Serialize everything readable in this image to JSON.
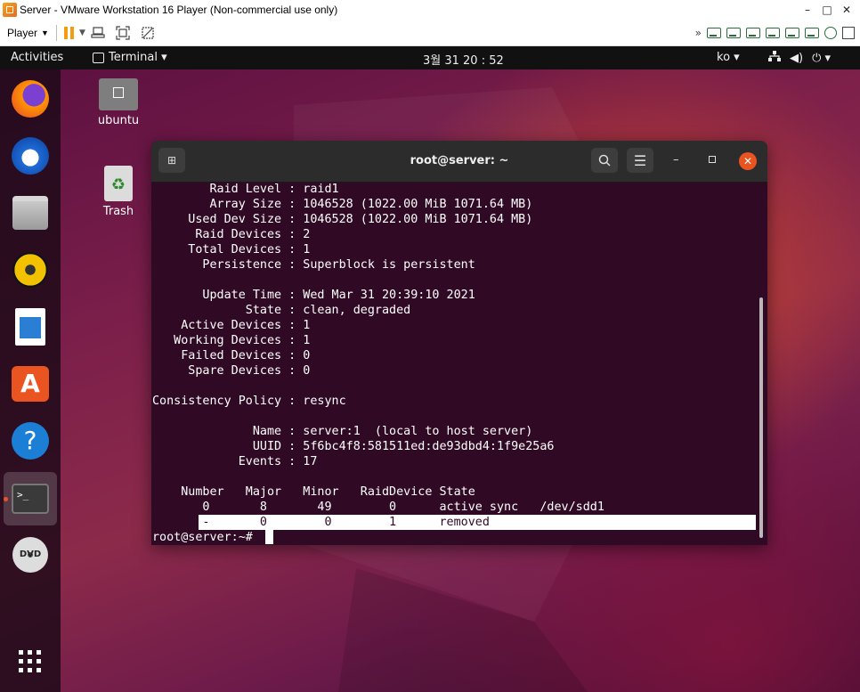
{
  "vmware": {
    "title": "Server - VMware Workstation 16 Player (Non-commercial use only)",
    "player_label": "Player",
    "min_label": "–",
    "max_label": "□",
    "close_label": "✕"
  },
  "topbar": {
    "activities": "Activities",
    "app_menu": "Terminal ▾",
    "clock": "3월 31  20 : 52",
    "input_method": "ko ▾"
  },
  "desktop": {
    "home_label": "ubuntu",
    "trash_label": "Trash"
  },
  "terminal": {
    "title": "root@server: ~",
    "lines": [
      "        Raid Level : raid1",
      "        Array Size : 1046528 (1022.00 MiB 1071.64 MB)",
      "     Used Dev Size : 1046528 (1022.00 MiB 1071.64 MB)",
      "      Raid Devices : 2",
      "     Total Devices : 1",
      "       Persistence : Superblock is persistent",
      "",
      "       Update Time : Wed Mar 31 20:39:10 2021",
      "             State : clean, degraded",
      "    Active Devices : 1",
      "   Working Devices : 1",
      "    Failed Devices : 0",
      "     Spare Devices : 0",
      "",
      "Consistency Policy : resync",
      "",
      "              Name : server:1  (local to host server)",
      "              UUID : 5f6bc4f8:581511ed:de93dbd4:1f9e25a6",
      "            Events : 17",
      "",
      "    Number   Major   Minor   RaidDevice State",
      "       0       8       49        0      active sync   /dev/sdd1"
    ],
    "highlight_line": "       -       0        0        1      removed",
    "prompt": "root@server:~# "
  },
  "colors": {
    "terminal_bg": "#300a24",
    "accent": "#e95420"
  }
}
